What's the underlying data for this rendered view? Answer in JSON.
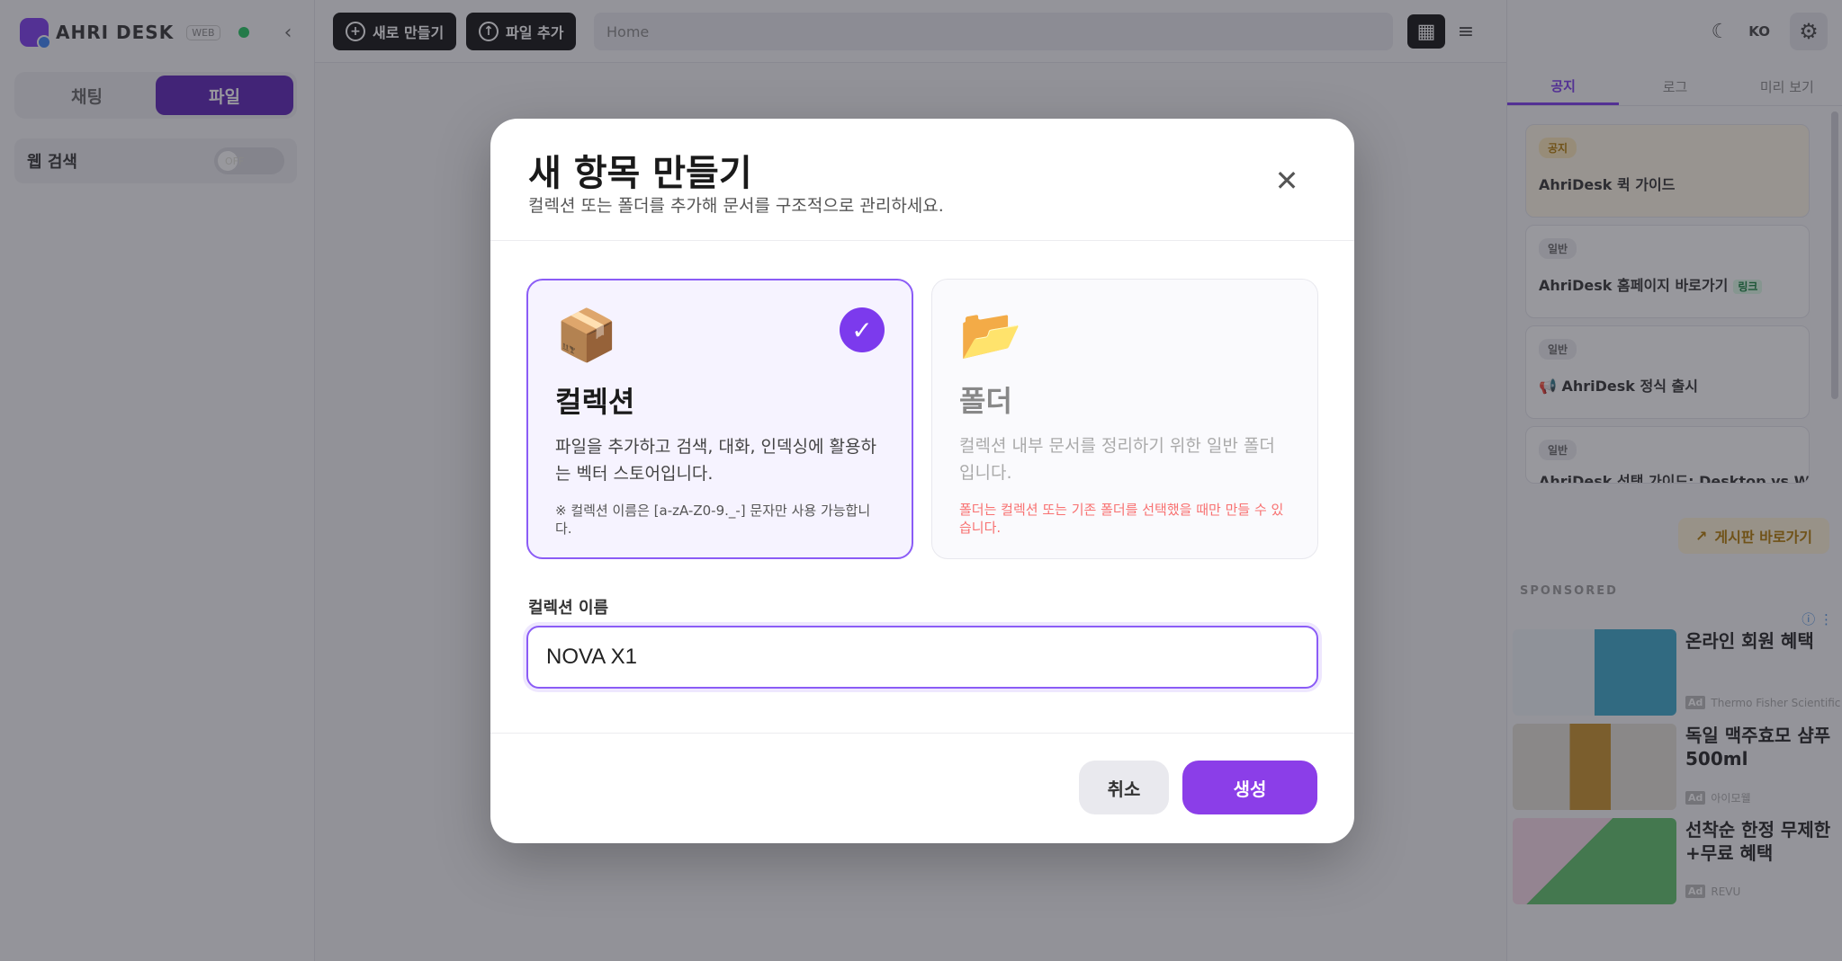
{
  "sidebar": {
    "brand": "AHRI DESK",
    "brand_tag": "WEB",
    "collapse_icon": "‹",
    "modes": [
      {
        "label": "채팅",
        "active": false
      },
      {
        "label": "파일",
        "active": true
      }
    ],
    "web_search": {
      "label": "웹 검색",
      "toggle": "OFF"
    }
  },
  "topbar": {
    "new_button": "새로 만들기",
    "upload_button": "파일 추가",
    "path": "Home"
  },
  "right_panel": {
    "lang": "KO",
    "tabs": [
      {
        "label": "공지",
        "active": true
      },
      {
        "label": "로그",
        "active": false
      },
      {
        "label": "미리 보기",
        "active": false
      }
    ],
    "notices": [
      {
        "badge": "공지",
        "title": "AhriDesk 퀵 가이드",
        "pinned": true,
        "tag": ""
      },
      {
        "badge": "일반",
        "title": "AhriDesk 홈페이지 바로가기",
        "pinned": false,
        "tag": "링크"
      },
      {
        "badge": "일반",
        "title": "📢 AhriDesk 정식 출시",
        "pinned": false,
        "tag": ""
      },
      {
        "badge": "일반",
        "title": "AhriDesk 선택 가이드: Desktop vs Web",
        "pinned": false,
        "tag": ""
      }
    ],
    "board_button": "게시판 바로가기",
    "sponsored_label": "SPONSORED",
    "ads": [
      {
        "title": "온라인 회원 혜택",
        "source": "Thermo Fisher Scientific",
        "color": "#3ba7c9"
      },
      {
        "title": "독일 맥주효모 샴푸 500ml",
        "source": "아이모웰",
        "color": "#c8902a"
      },
      {
        "title": "선착순 한정 무제한+무료 혜택",
        "source": "REVU",
        "color": "#5ec26a"
      }
    ]
  },
  "modal": {
    "title": "새 항목 만들기",
    "subtitle": "컬렉션 또는 폴더를 추가해 문서를 구조적으로 관리하세요.",
    "close_icon": "✕",
    "options": {
      "collection": {
        "emoji": "📦",
        "title": "컬렉션",
        "desc": "파일을 추가하고 검색, 대화, 인덱싱에 활용하는 벡터 스토어입니다.",
        "note": "※ 컬렉션 이름은 [a-zA-Z0-9._-] 문자만 사용 가능합니다.",
        "check": "✓",
        "selected": true
      },
      "folder": {
        "emoji": "📂",
        "title": "폴더",
        "desc": "컬렉션 내부 문서를 정리하기 위한 일반 폴더입니다.",
        "warning": "폴더는 컬렉션 또는 기존 폴더를 선택했을 때만 만들 수 있습니다.",
        "selected": false
      }
    },
    "field_label": "컬렉션 이름",
    "name_value": "NOVA X1",
    "cancel": "취소",
    "create": "생성"
  },
  "colors": {
    "accent": "#7c3aed",
    "accent_button": "#8b3ee8",
    "dark_button": "#111111",
    "status_online": "#22c55e"
  }
}
